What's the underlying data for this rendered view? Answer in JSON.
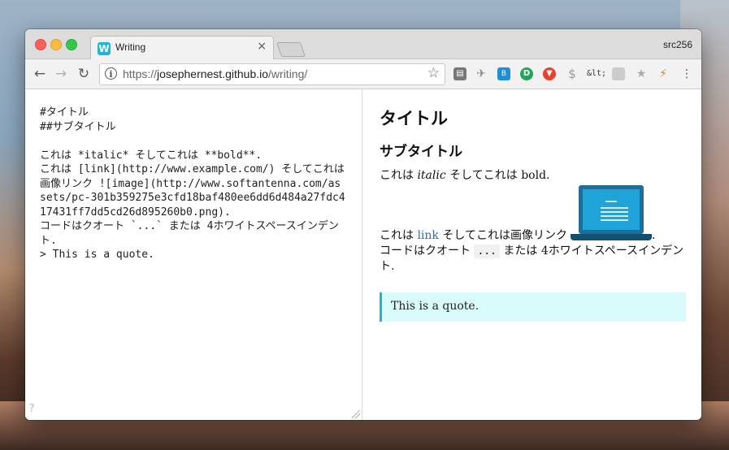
{
  "browser": {
    "tab_title": "Writing",
    "tab_favicon_letter": "W",
    "profile_name": "src256",
    "url": {
      "protocol": "https://",
      "host": "josephernest.github.io",
      "path": "/writing/"
    },
    "extensions": [
      "clipboard-icon",
      "pin-icon",
      "translate-icon",
      "d-icon",
      "pocket-icon",
      "dollar-icon",
      "html-entity-icon",
      "grey-box-icon",
      "star-extension-icon",
      "bolt-icon"
    ],
    "extension_text_amp": "&lt;"
  },
  "editor": {
    "lines": [
      "#タイトル",
      "##サブタイトル",
      "",
      "これは *italic* そしてこれは **bold**.",
      "これは [link](http://www.example.com/) そしてこれは画像リンク ![image](http://www.softantenna.com/assets/pc-301b359275e3cfd18baf480ee6dd6d484a27fdc417431ff7dd5cd26d895260b0.png).",
      "コードはクオート `...` または 4ホワイトスペースインデント.",
      "> This is a quote."
    ],
    "help_mark": "?"
  },
  "preview": {
    "h1": "タイトル",
    "h2": "サブタイトル",
    "p1_prefix": "これは",
    "p1_italic": "italic",
    "p1_middle": "そしてこれは",
    "p1_bold": "bold.",
    "p2_prefix": "これは",
    "p2_link": "link",
    "p2_suffix": "そしてこれは画像リンク",
    "p2_end": ".",
    "p3_prefix": "コードはクオート",
    "p3_code": "...",
    "p3_middle": "または",
    "p3_num": "4",
    "p3_suffix": "ホワイトスペースインデント.",
    "quote": "This is a quote."
  },
  "colors": {
    "accent": "#1fb5d8",
    "link": "#2a6fb2",
    "quote_bg": "#d9fbfb"
  }
}
